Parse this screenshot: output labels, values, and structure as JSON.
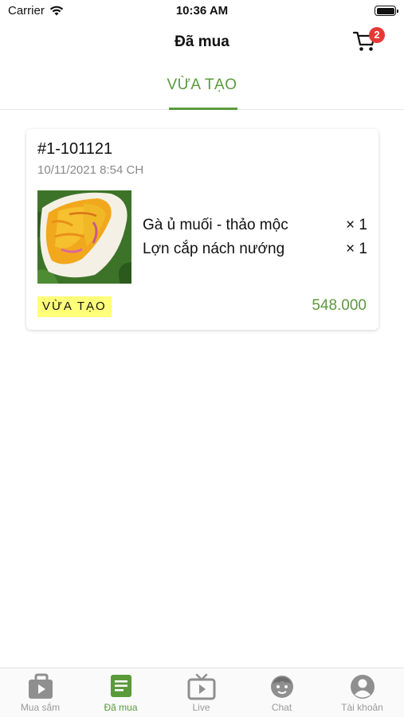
{
  "status_bar": {
    "carrier": "Carrier",
    "time": "10:36 AM"
  },
  "header": {
    "title": "Đã mua",
    "cart_count": "2"
  },
  "tabs": [
    {
      "label": "VỪA TẠO",
      "active": true
    }
  ],
  "order": {
    "id": "#1-101121",
    "date": "10/11/2021 8:54 CH",
    "thumbnail_icon": "food-photo",
    "items": [
      {
        "name": "Gà ủ muối - thảo mộc",
        "qty": "× 1"
      },
      {
        "name": "Lợn cắp nách nướng",
        "qty": "× 1"
      }
    ],
    "status": "VỪA TẠO",
    "total": "548.000"
  },
  "bottom_nav": [
    {
      "label": "Mua sắm",
      "icon": "video-bag-icon",
      "active": false
    },
    {
      "label": "Đã mua",
      "icon": "receipt-icon",
      "active": true
    },
    {
      "label": "Live",
      "icon": "tv-icon",
      "active": false
    },
    {
      "label": "Chat",
      "icon": "chat-face-icon",
      "active": false
    },
    {
      "label": "Tài khoản",
      "icon": "user-icon",
      "active": false
    }
  ],
  "colors": {
    "accent": "#5a9a3a",
    "badge_bg": "#ffff7a",
    "cart_badge": "#e53935",
    "inactive": "#9a9a9a"
  }
}
